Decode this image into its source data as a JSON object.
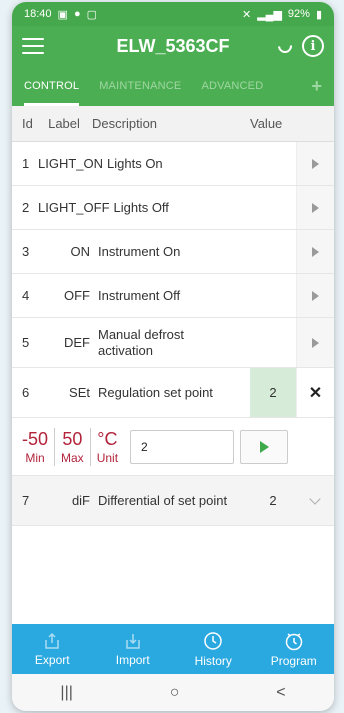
{
  "status": {
    "time": "18:40",
    "battery": "92%",
    "signal": "46"
  },
  "app": {
    "title": "ELW_5363CF"
  },
  "tabs": [
    {
      "label": "CONTROL",
      "active": true
    },
    {
      "label": "MAINTENANCE",
      "active": false
    },
    {
      "label": "ADVANCED",
      "active": false
    }
  ],
  "table": {
    "headers": {
      "id": "Id",
      "label": "Label",
      "description": "Description",
      "value": "Value"
    },
    "rows": [
      {
        "id": "1",
        "label": "LIGHT_ON",
        "description": "Lights On",
        "value": ""
      },
      {
        "id": "2",
        "label": "LIGHT_OFF",
        "description": "Lights Off",
        "value": ""
      },
      {
        "id": "3",
        "label": "ON",
        "description": "Instrument On",
        "value": ""
      },
      {
        "id": "4",
        "label": "OFF",
        "description": "Instrument Off",
        "value": ""
      },
      {
        "id": "5",
        "label": "DEF",
        "description": "Manual defrost activation",
        "value": ""
      },
      {
        "id": "6",
        "label": "SEt",
        "description": "Regulation set point",
        "value": "2"
      },
      {
        "id": "7",
        "label": "diF",
        "description": "Differential of set point",
        "value": "2"
      }
    ]
  },
  "editor": {
    "min_value": "-50",
    "min_label": "Min",
    "max_value": "50",
    "max_label": "Max",
    "unit_value": "°C",
    "unit_label": "Unit",
    "input_value": "2"
  },
  "bottom_nav": [
    {
      "label": "Export",
      "icon": "export-icon"
    },
    {
      "label": "Import",
      "icon": "import-icon"
    },
    {
      "label": "History",
      "icon": "history-icon"
    },
    {
      "label": "Program",
      "icon": "program-icon"
    }
  ],
  "system_nav": {
    "recents": "|||",
    "home": "○",
    "back": "<"
  },
  "colors": {
    "primary_green": "#4cae52",
    "bottom_blue": "#2aa8e0",
    "accent_red": "#b3243b",
    "selected_value_bg": "#d6ecd8"
  }
}
